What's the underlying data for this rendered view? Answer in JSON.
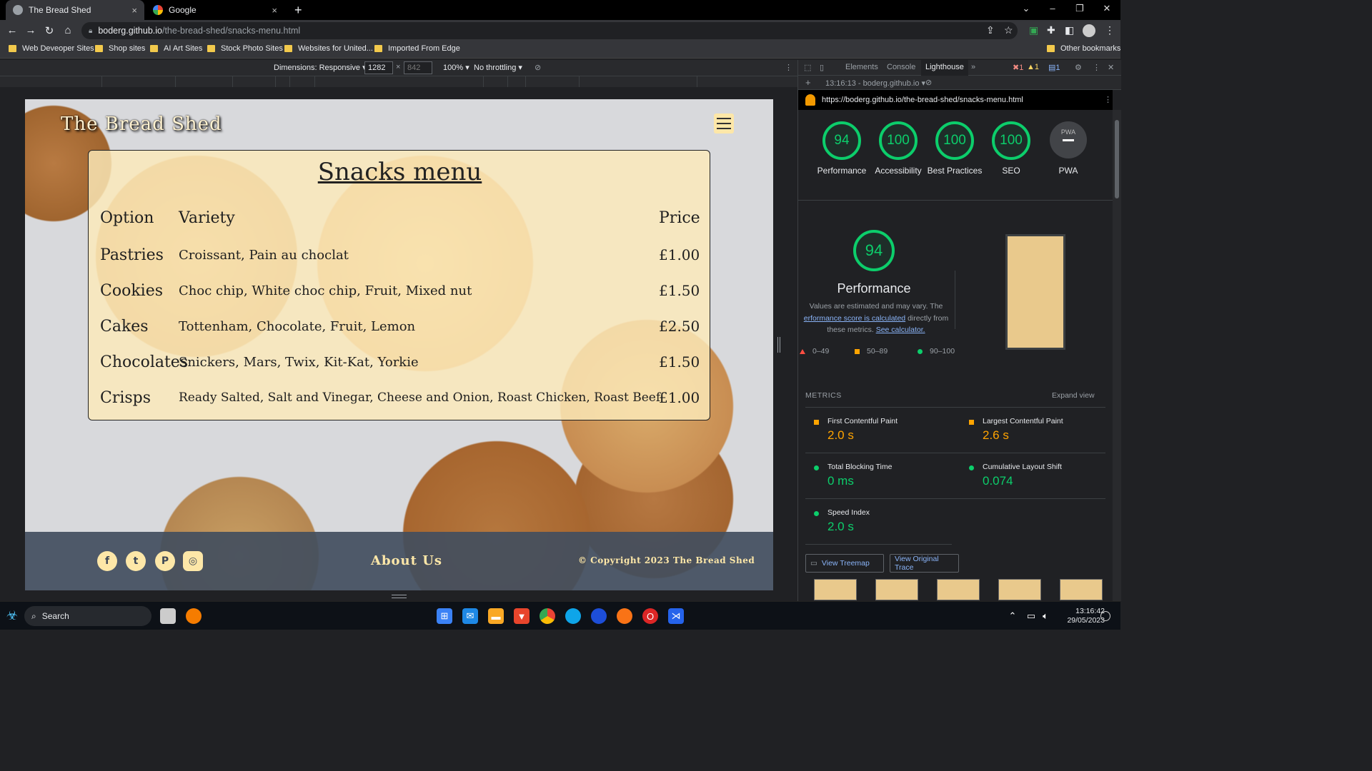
{
  "browser": {
    "tabs": [
      {
        "title": "The Bread Shed",
        "close": "×"
      },
      {
        "title": "Google",
        "close": "×"
      }
    ],
    "new_tab": "+",
    "url_host": "boderg.github.io",
    "url_path": "/the-bread-shed/snacks-menu.html",
    "bookmarks": [
      "Web Deveoper Sites",
      "Shop sites",
      "AI Art Sites",
      "Stock Photo Sites",
      "Websites for United...",
      "Imported From Edge"
    ],
    "other_bookmarks": "Other bookmarks"
  },
  "device_toolbar": {
    "dimensions_label": "Dimensions: Responsive ▾",
    "width": "1282",
    "height": "842",
    "times": "×",
    "zoom": "100% ▾",
    "throttle": "No throttling ▾"
  },
  "site": {
    "title": "The Bread Shed",
    "menu_title": "Snacks menu",
    "headers": {
      "option": "Option",
      "variety": "Variety",
      "price": "Price"
    },
    "rows": [
      {
        "option": "Pastries",
        "variety": "Croissant, Pain au choclat",
        "price": "£1.00"
      },
      {
        "option": "Cookies",
        "variety": "Choc chip, White choc chip, Fruit, Mixed nut",
        "price": "£1.50"
      },
      {
        "option": "Cakes",
        "variety": "Tottenham, Chocolate, Fruit, Lemon",
        "price": "£2.50"
      },
      {
        "option": "Chocolates",
        "variety": "Snickers, Mars, Twix, Kit-Kat, Yorkie",
        "price": "£1.50"
      },
      {
        "option": "Crisps",
        "variety": "Ready Salted, Salt and Vinegar, Cheese and Onion, Roast Chicken, Roast Beef",
        "price": "£1.00"
      }
    ],
    "footer": {
      "about": "About Us",
      "copyright": "© Copyright 2023 The Bread Shed",
      "social_icons": [
        "facebook-icon",
        "twitter-icon",
        "pinterest-icon",
        "instagram-icon"
      ]
    }
  },
  "devtools": {
    "tabs": [
      "Elements",
      "Console",
      "Lighthouse"
    ],
    "active_tab": "Lighthouse",
    "badges": {
      "errors": "1",
      "warnings": "1",
      "messages": "1"
    },
    "report_time": "13:16:13 - boderg.github.io ▾",
    "report_url": "https://boderg.github.io/the-bread-shed/snacks-menu.html",
    "scores": [
      {
        "label": "Performance",
        "value": "94"
      },
      {
        "label": "Accessibility",
        "value": "100"
      },
      {
        "label": "Best Practices",
        "value": "100"
      },
      {
        "label": "SEO",
        "value": "100"
      }
    ],
    "pwa": {
      "label": "PWA",
      "badge": "PWA"
    },
    "performance": {
      "score": "94",
      "title": "Performance",
      "note_start": "Values are estimated and may vary. The ",
      "note_link": "erformance score is calculated",
      "note_mid": " directly from these metrics. ",
      "note_link2": "See calculator."
    },
    "legend": [
      "0–49",
      "50–89",
      "90–100"
    ],
    "metrics_label": "METRICS",
    "expand": "Expand view",
    "metrics": [
      {
        "name": "First Contentful Paint",
        "value": "2.0 s",
        "status": "average"
      },
      {
        "name": "Largest Contentful Paint",
        "value": "2.6 s",
        "status": "average"
      },
      {
        "name": "Total Blocking Time",
        "value": "0 ms",
        "status": "pass"
      },
      {
        "name": "Cumulative Layout Shift",
        "value": "0.074",
        "status": "pass"
      },
      {
        "name": "Speed Index",
        "value": "2.0 s",
        "status": "pass"
      }
    ],
    "buttons": {
      "treemap": "View Treemap",
      "trace": "View Original Trace"
    }
  },
  "taskbar": {
    "search": "Search",
    "time": "13:16:42",
    "date": "29/05/2023"
  },
  "colors": {
    "pass": "#0cce6b",
    "average": "#ffa400",
    "fail": "#ff4e42",
    "accent": "#fde7a8"
  }
}
